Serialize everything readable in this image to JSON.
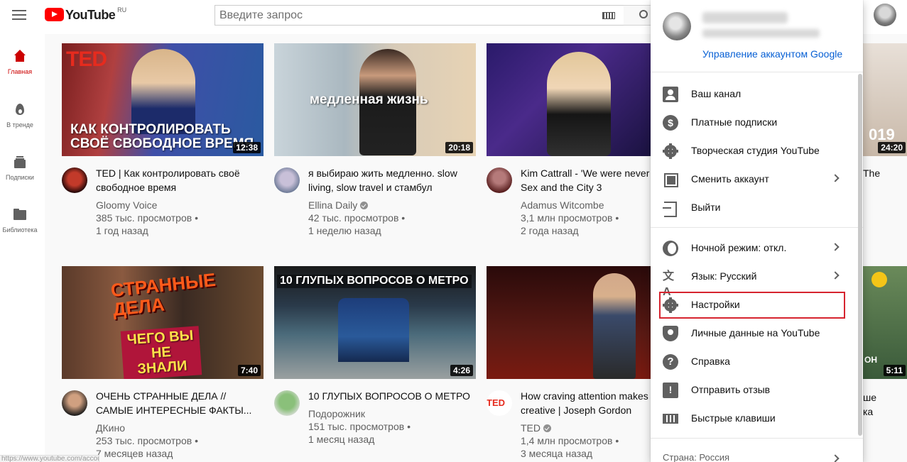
{
  "header": {
    "logo_text": "YouTube",
    "logo_region": "RU",
    "search_placeholder": "Введите запрос"
  },
  "sidebar": {
    "items": [
      {
        "label": "Главная",
        "icon": "home-icon",
        "active": true
      },
      {
        "label": "В тренде",
        "icon": "trending-icon",
        "active": false
      },
      {
        "label": "Подписки",
        "icon": "subscriptions-icon",
        "active": false
      },
      {
        "label": "Библиотека",
        "icon": "library-icon",
        "active": false
      }
    ]
  },
  "videos": [
    {
      "title": "TED | Как контролировать своё свободное время",
      "channel": "Gloomy Voice",
      "verified": false,
      "views": "385 тыс. просмотров •",
      "age": "1 год назад",
      "duration": "12:38",
      "overlay": "КАК КОНТРОЛИРОВАТЬ СВОЁ СВОБОДНОЕ ВРЕМЯ",
      "badge": "TED"
    },
    {
      "title": "я выбираю жить медленно. slow living, slow travel и стамбул",
      "channel": "Ellina Daily",
      "verified": true,
      "views": "42 тыс. просмотров •",
      "age": "1 неделю назад",
      "duration": "20:18",
      "overlay": "медленная жизнь"
    },
    {
      "title": "Kim Cattrall - 'We were never friends' Sex and the City 3",
      "channel": "Adamus Witcombe",
      "verified": false,
      "views": "3,1 млн просмотров •",
      "age": "2 года назад",
      "duration": ""
    },
    {
      "title": "ОЧЕНЬ СТРАННЫЕ ДЕЛА // САМЫЕ ИНТЕРЕСНЫЕ ФАКТЫ...",
      "channel": "ДКино",
      "verified": false,
      "views": "253 тыс. просмотров •",
      "age": "7 месяцев назад",
      "duration": "7:40",
      "overlay": "СТРАННЫЕ ДЕЛА",
      "overlay2": "ЧЕГО ВЫ НЕ ЗНАЛИ"
    },
    {
      "title": "10 ГЛУПЫХ ВОПРОСОВ О МЕТРО",
      "channel": "Подорожник",
      "verified": false,
      "views": "151 тыс. просмотров •",
      "age": "1 месяц назад",
      "duration": "4:26",
      "overlay": "10 ГЛУПЫХ ВОПРОСОВ О МЕТРО"
    },
    {
      "title": "How craving attention makes less creative | Joseph Gordon",
      "channel": "TED",
      "verified": true,
      "views": "1,4 млн просмотров •",
      "age": "3 месяца назад",
      "duration": "",
      "channel_badge": "TED"
    }
  ],
  "partial_right": {
    "top_duration": "24:20",
    "top_thumb_text": "019",
    "top_title_text": "The",
    "bottom_duration": "5:11",
    "bottom_thumb_text": "ОН",
    "bottom_title_text": "ше",
    "bottom_title_text2": "ка"
  },
  "account_menu": {
    "manage_link": "Управление аккаунтом Google",
    "section1": [
      {
        "label": "Ваш канал",
        "icon": "user-icon",
        "chevron": false
      },
      {
        "label": "Платные подписки",
        "icon": "dollar-icon",
        "chevron": false
      },
      {
        "label": "Творческая студия YouTube",
        "icon": "gear-icon",
        "chevron": false
      },
      {
        "label": "Сменить аккаунт",
        "icon": "switch-account-icon",
        "chevron": true
      },
      {
        "label": "Выйти",
        "icon": "exit-icon",
        "chevron": false
      }
    ],
    "section2": [
      {
        "label": "Ночной режим: откл.",
        "icon": "moon-icon",
        "chevron": true
      },
      {
        "label": "Язык: Русский",
        "icon": "language-icon",
        "chevron": true
      },
      {
        "label": "Настройки",
        "icon": "settings-icon",
        "chevron": false
      },
      {
        "label": "Личные данные на YouTube",
        "icon": "shield-icon",
        "chevron": false
      },
      {
        "label": "Справка",
        "icon": "help-icon",
        "chevron": false
      },
      {
        "label": "Отправить отзыв",
        "icon": "feedback-icon",
        "chevron": false
      },
      {
        "label": "Быстрые клавиши",
        "icon": "keyboard-icon",
        "chevron": false
      }
    ],
    "footer": "Страна: Россия",
    "highlighted_item": "Настройки"
  },
  "status_bar": {
    "url": "https://www.youtube.com/account"
  },
  "colors": {
    "brand": "#ff0000",
    "link": "#065fd4",
    "highlight_border": "#d6242f"
  }
}
